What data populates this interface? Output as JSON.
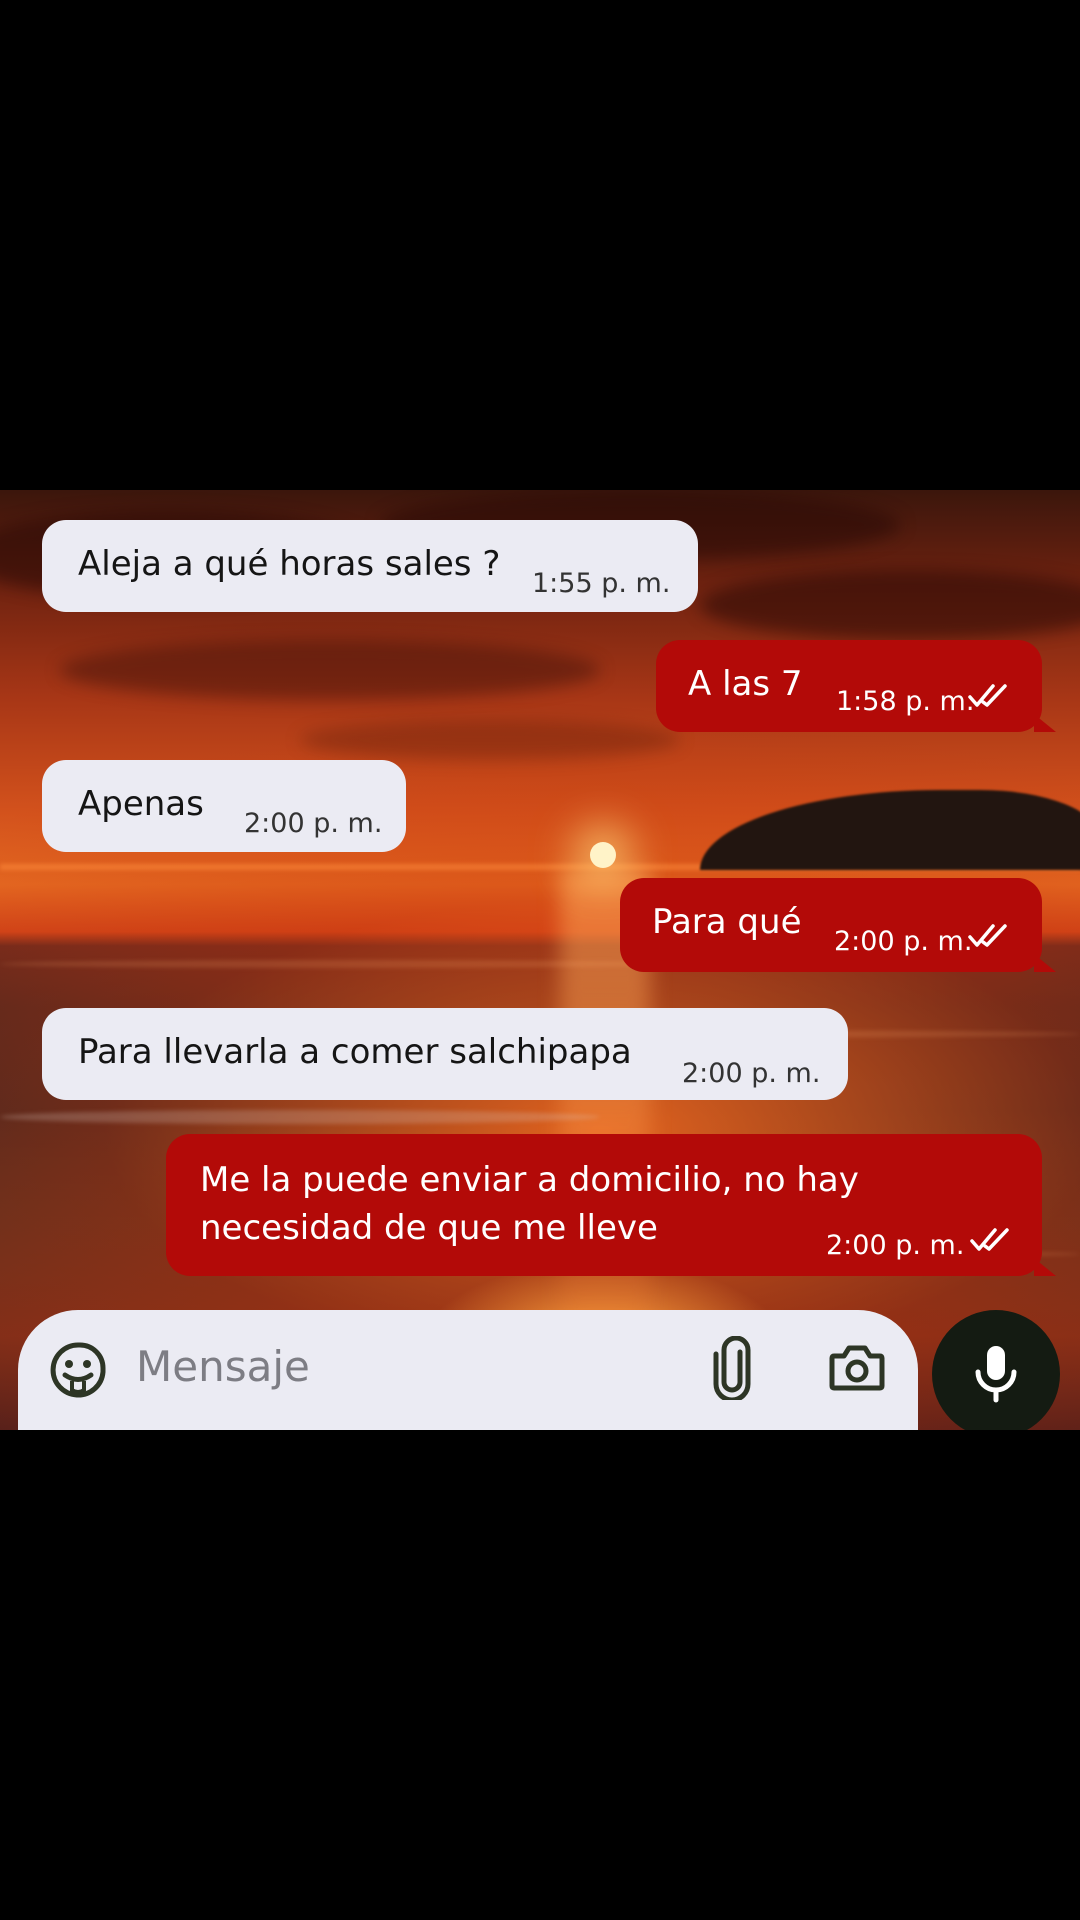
{
  "chat": {
    "messages": [
      {
        "direction": "incoming",
        "text": "Aleja a qué horas sales ?",
        "time": "1:55 p. m."
      },
      {
        "direction": "outgoing",
        "text": "A las 7",
        "time": "1:58 p. m.",
        "status": "read"
      },
      {
        "direction": "incoming",
        "text": "Apenas",
        "time": "2:00 p. m."
      },
      {
        "direction": "outgoing",
        "text": "Para qué",
        "time": "2:00 p. m.",
        "status": "read"
      },
      {
        "direction": "incoming",
        "text": "Para llevarla a comer salchipapa",
        "time": "2:00 p. m."
      },
      {
        "direction": "outgoing",
        "text_line1": "Me la puede enviar a domicilio, no hay",
        "text_line2": "necesidad de que me lleve",
        "time": "2:00 p. m.",
        "status": "read"
      }
    ]
  },
  "composer": {
    "placeholder": "Mensaje",
    "emoji_icon": "sticker-emoji-icon",
    "attach_icon": "paperclip-icon",
    "camera_icon": "camera-icon",
    "mic_icon": "microphone-icon"
  },
  "colors": {
    "incoming_bubble": "#ebebf3",
    "outgoing_bubble": "#b30a08",
    "mic_button": "#141b12",
    "letterbox": "#000000"
  }
}
